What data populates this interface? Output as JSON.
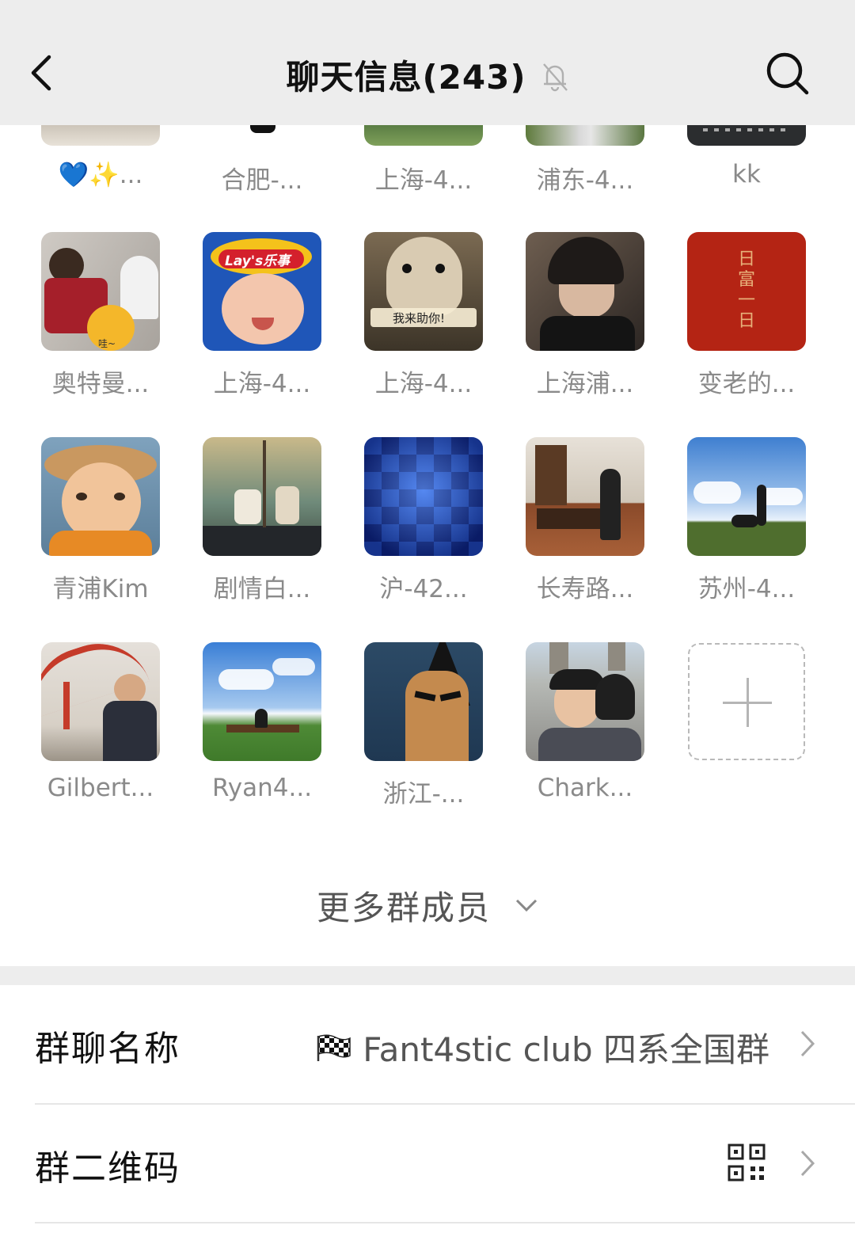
{
  "header": {
    "title": "聊天信息(243)",
    "back_icon": "chevron-left-icon",
    "mute_icon": "bell-off-icon",
    "search_icon": "search-icon"
  },
  "members": [
    {
      "name": "💙✨..."
    },
    {
      "name": "合肥-..."
    },
    {
      "name": "上海-4..."
    },
    {
      "name": "浦东-4..."
    },
    {
      "name": "kk"
    },
    {
      "name": "奥特曼..."
    },
    {
      "name": "上海-4..."
    },
    {
      "name": "上海-4..."
    },
    {
      "name": "上海浦..."
    },
    {
      "name": "变老的..."
    },
    {
      "name": "青浦Kim"
    },
    {
      "name": "剧情白..."
    },
    {
      "name": "沪-42..."
    },
    {
      "name": "长寿路..."
    },
    {
      "name": "苏州-4..."
    },
    {
      "name": "Gilbert..."
    },
    {
      "name": "Ryan4..."
    },
    {
      "name": "浙江-..."
    },
    {
      "name": "Chark..."
    }
  ],
  "avatar_texts": {
    "lays": "Lay's乐事",
    "hamster": "我来助你!",
    "red": "日富一日",
    "emoji": "哇~"
  },
  "add_member_icon": "plus-icon",
  "more_members": {
    "label": "更多群成员",
    "icon": "chevron-down-icon"
  },
  "settings": {
    "group_name": {
      "label": "群聊名称",
      "value": "Fant4stic club 四系全国群",
      "flag_icon": "checkered-flag-icon"
    },
    "group_qr": {
      "label": "群二维码",
      "icon": "qr-code-icon"
    }
  }
}
